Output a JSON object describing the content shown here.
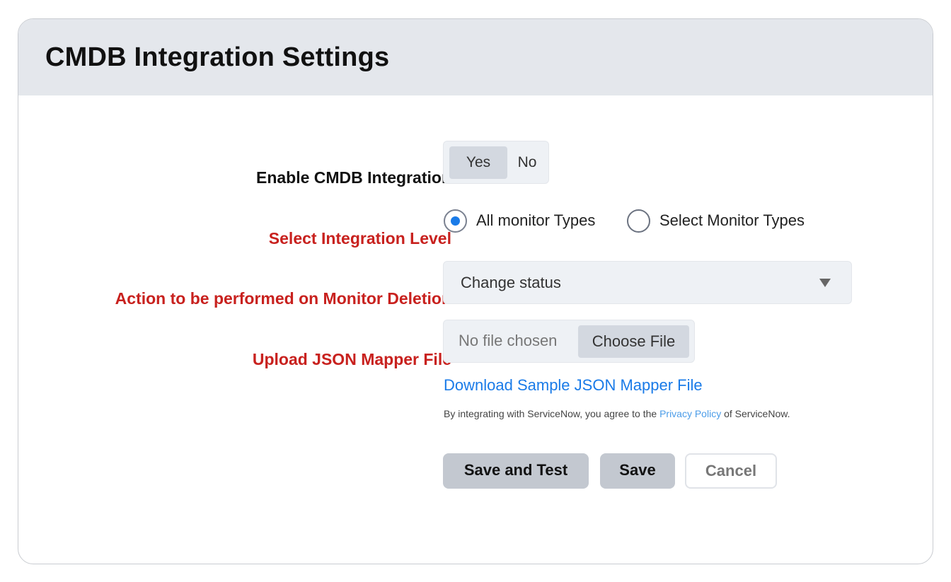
{
  "header": {
    "title": "CMDB Integration Settings"
  },
  "form": {
    "enable": {
      "label": "Enable CMDB Integration",
      "options": [
        "Yes",
        "No"
      ],
      "selected": "Yes"
    },
    "level": {
      "label": "Select Integration Level",
      "options": [
        "All monitor Types",
        "Select Monitor Types"
      ],
      "selected": "All monitor Types"
    },
    "deletion_action": {
      "label": "Action to be performed on Monitor Deletion",
      "value": "Change status"
    },
    "upload": {
      "label": "Upload JSON Mapper File",
      "status": "No file chosen",
      "button": "Choose File"
    },
    "download_link": "Download Sample JSON Mapper File",
    "agreement": {
      "prefix": "By integrating with ServiceNow, you agree to the ",
      "link": "Privacy Policy",
      "suffix": " of ServiceNow."
    }
  },
  "actions": {
    "save_test": "Save and Test",
    "save": "Save",
    "cancel": "Cancel"
  },
  "colors": {
    "required_label": "#c8211e",
    "link": "#1a7be8",
    "header_bg": "#e4e7ec"
  },
  "icons": {
    "dropdown": "caret-down-icon"
  }
}
